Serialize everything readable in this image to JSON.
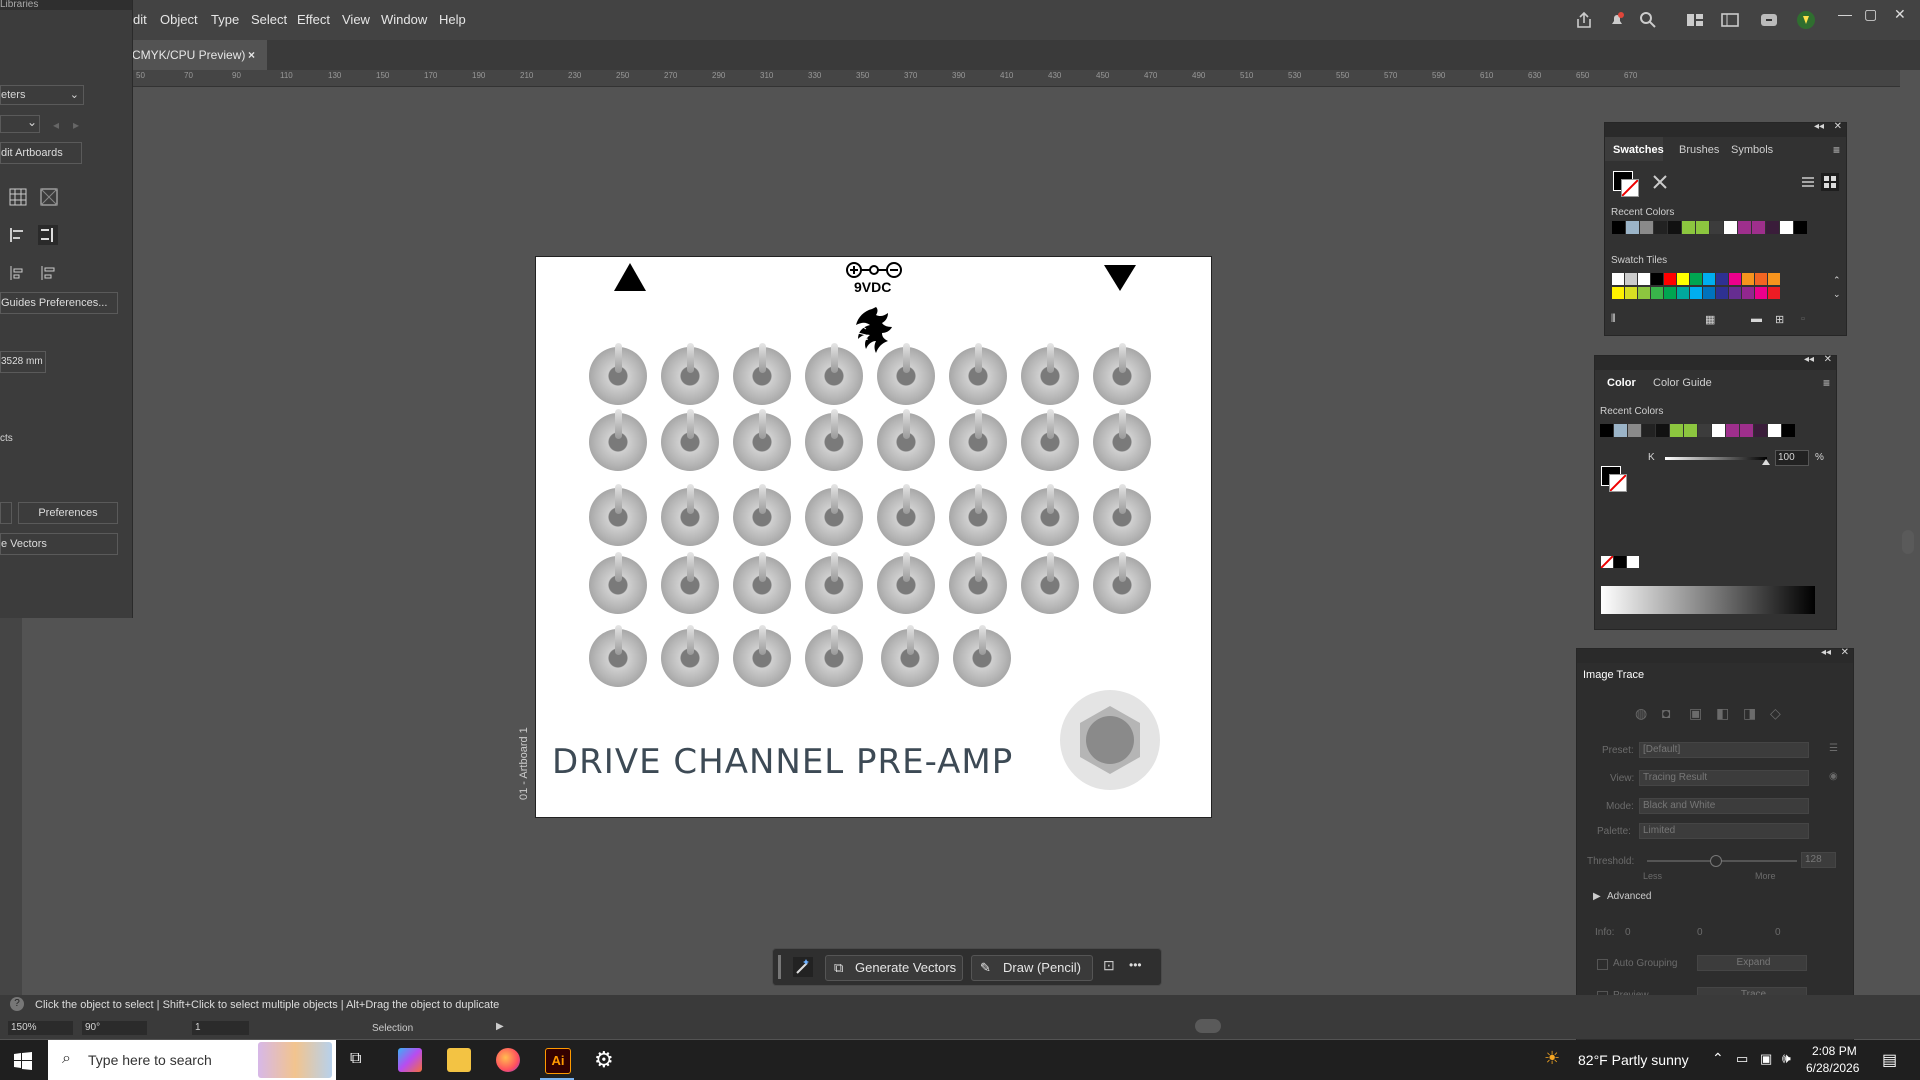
{
  "menu": {
    "items": [
      "dit",
      "Object",
      "Type",
      "Select",
      "Effect",
      "View",
      "Window",
      "Help"
    ]
  },
  "document": {
    "tab_title": "CMYK/CPU Preview)",
    "close": "×",
    "ruler_marks": [
      "50",
      "70",
      "90",
      "110",
      "130",
      "150",
      "170",
      "190",
      "210",
      "230",
      "250",
      "270",
      "290",
      "310",
      "330",
      "350",
      "370",
      "390",
      "410",
      "430",
      "450",
      "470",
      "490",
      "510",
      "530",
      "550",
      "570",
      "590",
      "610",
      "630",
      "650",
      "670"
    ]
  },
  "left_panel": {
    "header": "Libraries",
    "dropdown": "eters",
    "edit_artboards": "dit Artboards",
    "guides_prefs": "Guides Preferences...",
    "measurement": "3528 mm",
    "label_cts": "cts",
    "preferences": "Preferences",
    "vectors": "e Vectors"
  },
  "artboard": {
    "label": "01 - Artboard 1",
    "power_text": "9VDC",
    "title": "DRIVE CHANNEL PRE-AMP"
  },
  "swatches_panel": {
    "tabs": [
      "Swatches",
      "Brushes",
      "Symbols"
    ],
    "recent_label": "Recent Colors",
    "tiles_label": "Swatch Tiles",
    "recent_colors": [
      "#000000",
      "#9bb4c8",
      "#8a8a8a",
      "#222222",
      "#111111",
      "#8cc63f",
      "#8cc63f",
      "#3c3c3c",
      "#ffffff",
      "#9e2f8c",
      "#9e2f8c",
      "#3a1d3a",
      "#ffffff",
      "#000000"
    ],
    "tile_colors_row1": [
      "#ffffff",
      "#cccccc",
      "#ffffff",
      "#000000",
      "#ff0000",
      "#ffff00",
      "#00a651",
      "#00aeef",
      "#2e3192",
      "#ec008c",
      "#f7941d",
      "#f26522",
      "#f7941d"
    ],
    "tile_colors_row2": [
      "#fff200",
      "#d7df23",
      "#8dc63f",
      "#39b54a",
      "#00a651",
      "#00a99d",
      "#00aeef",
      "#0072bc",
      "#2e3192",
      "#662d91",
      "#92278f",
      "#ec008c",
      "#ed1c24"
    ]
  },
  "color_panel": {
    "tabs": [
      "Color",
      "Color Guide"
    ],
    "recent_label": "Recent Colors",
    "channel": "K",
    "value": "100",
    "unit": "%",
    "recent_colors": [
      "#000000",
      "#9bb4c8",
      "#8a8a8a",
      "#222222",
      "#111111",
      "#8cc63f",
      "#8cc63f",
      "#3c3c3c",
      "#ffffff",
      "#9e2f8c",
      "#9e2f8c",
      "#3a1d3a",
      "#ffffff",
      "#000000"
    ]
  },
  "image_trace": {
    "title": "Image Trace",
    "preset_label": "Preset:",
    "preset_value": "[Default]",
    "view_label": "View:",
    "view_value": "Tracing Result",
    "mode_label": "Mode:",
    "mode_value": "Black and White",
    "palette_label": "Palette:",
    "palette_value": "Limited",
    "threshold_label": "Threshold:",
    "threshold_value": "128",
    "less": "Less",
    "more": "More",
    "advanced": "Advanced",
    "info_label": "Info:",
    "info_values": [
      "0",
      "0",
      "0"
    ],
    "auto_grouping": "Auto Grouping",
    "expand": "Expand",
    "preview": "Preview",
    "trace": "Trace"
  },
  "context_bar": {
    "generate": "Generate Vectors",
    "draw": "Draw (Pencil)",
    "more": "•••"
  },
  "status": {
    "hint": "Click the object to select  |  Shift+Click to select multiple objects  |  Alt+Drag the object to duplicate",
    "zoom": "150%",
    "rotation": "90°",
    "artboard_num": "1",
    "tool": "Selection"
  },
  "taskbar": {
    "search_placeholder": "Type here to search",
    "weather": "82°F  Partly sunny",
    "time": "2:08 PM",
    "date": "6/28/2026"
  }
}
